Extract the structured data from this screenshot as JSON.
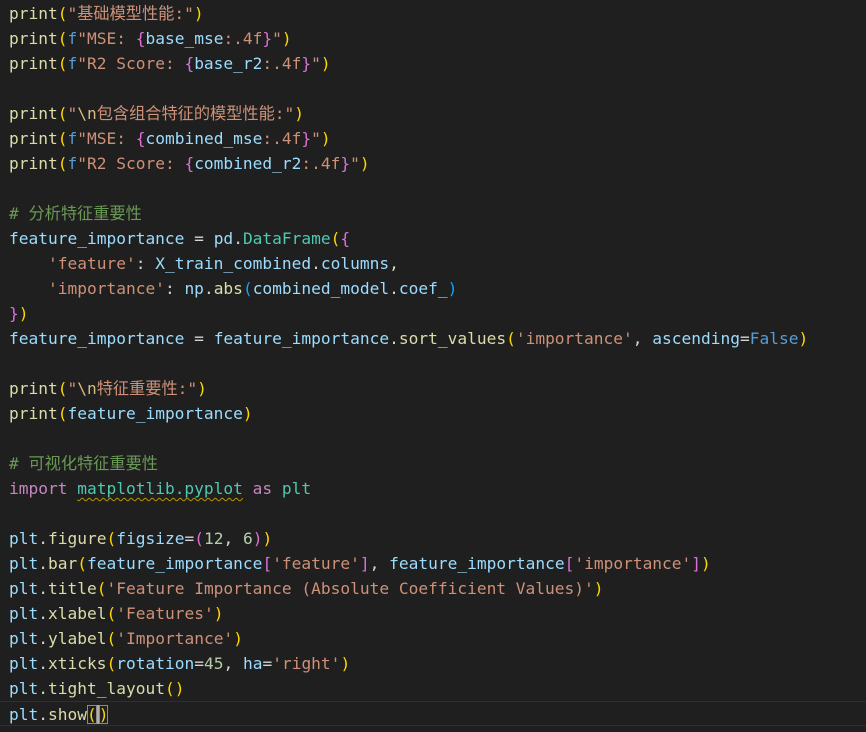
{
  "editor": {
    "colors": {
      "background": "#1f1f1f",
      "function": "#dcdcaa",
      "string": "#ce9178",
      "variable": "#9cdcfe",
      "comment": "#6a9955",
      "keyword": "#c586c0",
      "storage": "#569cd6",
      "class": "#4ec9b0",
      "number": "#b5cea8",
      "escape": "#d7ba7d",
      "plain": "#d4d4d4",
      "bracket1": "#ffd700",
      "bracket2": "#da70d6",
      "bracket3": "#179fff"
    },
    "current_line": 28,
    "lines": [
      [
        [
          "print",
          "fn"
        ],
        [
          "(",
          "b1"
        ],
        [
          "\"基础模型性能:\"",
          "str"
        ],
        [
          ")",
          "b1"
        ]
      ],
      [
        [
          "print",
          "fn"
        ],
        [
          "(",
          "b1"
        ],
        [
          "f",
          "kw2"
        ],
        [
          "\"MSE: ",
          "str"
        ],
        [
          "{",
          "b2"
        ],
        [
          "base_mse",
          "var"
        ],
        [
          ":.4f",
          "str"
        ],
        [
          "}",
          "b2"
        ],
        [
          "\"",
          "str"
        ],
        [
          ")",
          "b1"
        ]
      ],
      [
        [
          "print",
          "fn"
        ],
        [
          "(",
          "b1"
        ],
        [
          "f",
          "kw2"
        ],
        [
          "\"R2 Score: ",
          "str"
        ],
        [
          "{",
          "b2"
        ],
        [
          "base_r2",
          "var"
        ],
        [
          ":.4f",
          "str"
        ],
        [
          "}",
          "b2"
        ],
        [
          "\"",
          "str"
        ],
        [
          ")",
          "b1"
        ]
      ],
      [],
      [
        [
          "print",
          "fn"
        ],
        [
          "(",
          "b1"
        ],
        [
          "\"",
          "str"
        ],
        [
          "\\n",
          "esc"
        ],
        [
          "包含组合特征的模型性能:\"",
          "str"
        ],
        [
          ")",
          "b1"
        ]
      ],
      [
        [
          "print",
          "fn"
        ],
        [
          "(",
          "b1"
        ],
        [
          "f",
          "kw2"
        ],
        [
          "\"MSE: ",
          "str"
        ],
        [
          "{",
          "b2"
        ],
        [
          "combined_mse",
          "var"
        ],
        [
          ":.4f",
          "str"
        ],
        [
          "}",
          "b2"
        ],
        [
          "\"",
          "str"
        ],
        [
          ")",
          "b1"
        ]
      ],
      [
        [
          "print",
          "fn"
        ],
        [
          "(",
          "b1"
        ],
        [
          "f",
          "kw2"
        ],
        [
          "\"R2 Score: ",
          "str"
        ],
        [
          "{",
          "b2"
        ],
        [
          "combined_r2",
          "var"
        ],
        [
          ":.4f",
          "str"
        ],
        [
          "}",
          "b2"
        ],
        [
          "\"",
          "str"
        ],
        [
          ")",
          "b1"
        ]
      ],
      [],
      [
        [
          "# 分析特征重要性",
          "cmt"
        ]
      ],
      [
        [
          "feature_importance",
          "var"
        ],
        [
          " = ",
          "pl"
        ],
        [
          "pd",
          "var"
        ],
        [
          ".",
          "pl"
        ],
        [
          "DataFrame",
          "cls"
        ],
        [
          "(",
          "b1"
        ],
        [
          "{",
          "b2"
        ]
      ],
      [
        [
          "    ",
          "pl"
        ],
        [
          "'feature'",
          "str"
        ],
        [
          ": ",
          "pl"
        ],
        [
          "X_train_combined",
          "var"
        ],
        [
          ".",
          "pl"
        ],
        [
          "columns",
          "var"
        ],
        [
          ",",
          "pl"
        ]
      ],
      [
        [
          "    ",
          "pl"
        ],
        [
          "'importance'",
          "str"
        ],
        [
          ": ",
          "pl"
        ],
        [
          "np",
          "var"
        ],
        [
          ".",
          "pl"
        ],
        [
          "abs",
          "fn"
        ],
        [
          "(",
          "b3"
        ],
        [
          "combined_model",
          "var"
        ],
        [
          ".",
          "pl"
        ],
        [
          "coef_",
          "var"
        ],
        [
          ")",
          "b3"
        ]
      ],
      [
        [
          "}",
          "b2"
        ],
        [
          ")",
          "b1"
        ]
      ],
      [
        [
          "feature_importance",
          "var"
        ],
        [
          " = ",
          "pl"
        ],
        [
          "feature_importance",
          "var"
        ],
        [
          ".",
          "pl"
        ],
        [
          "sort_values",
          "fn"
        ],
        [
          "(",
          "b1"
        ],
        [
          "'importance'",
          "str"
        ],
        [
          ", ",
          "pl"
        ],
        [
          "ascending",
          "var"
        ],
        [
          "=",
          "pl"
        ],
        [
          "False",
          "kw2"
        ],
        [
          ")",
          "b1"
        ]
      ],
      [],
      [
        [
          "print",
          "fn"
        ],
        [
          "(",
          "b1"
        ],
        [
          "\"",
          "str"
        ],
        [
          "\\n",
          "esc"
        ],
        [
          "特征重要性:\"",
          "str"
        ],
        [
          ")",
          "b1"
        ]
      ],
      [
        [
          "print",
          "fn"
        ],
        [
          "(",
          "b1"
        ],
        [
          "feature_importance",
          "var"
        ],
        [
          ")",
          "b1"
        ]
      ],
      [],
      [
        [
          "# 可视化特征重要性",
          "cmt"
        ]
      ],
      [
        [
          "import",
          "kw"
        ],
        [
          " ",
          "pl"
        ],
        [
          "matplotlib.pyplot",
          "cls sq"
        ],
        [
          " ",
          "pl"
        ],
        [
          "as",
          "kw"
        ],
        [
          " ",
          "pl"
        ],
        [
          "plt",
          "cls"
        ]
      ],
      [],
      [
        [
          "plt",
          "var"
        ],
        [
          ".",
          "pl"
        ],
        [
          "figure",
          "fn"
        ],
        [
          "(",
          "b1"
        ],
        [
          "figsize",
          "var"
        ],
        [
          "=",
          "pl"
        ],
        [
          "(",
          "b2"
        ],
        [
          "12",
          "num"
        ],
        [
          ", ",
          "pl"
        ],
        [
          "6",
          "num"
        ],
        [
          ")",
          "b2"
        ],
        [
          ")",
          "b1"
        ]
      ],
      [
        [
          "plt",
          "var"
        ],
        [
          ".",
          "pl"
        ],
        [
          "bar",
          "fn"
        ],
        [
          "(",
          "b1"
        ],
        [
          "feature_importance",
          "var"
        ],
        [
          "[",
          "b2"
        ],
        [
          "'feature'",
          "str"
        ],
        [
          "]",
          "b2"
        ],
        [
          ", ",
          "pl"
        ],
        [
          "feature_importance",
          "var"
        ],
        [
          "[",
          "b2"
        ],
        [
          "'importance'",
          "str"
        ],
        [
          "]",
          "b2"
        ],
        [
          ")",
          "b1"
        ]
      ],
      [
        [
          "plt",
          "var"
        ],
        [
          ".",
          "pl"
        ],
        [
          "title",
          "fn"
        ],
        [
          "(",
          "b1"
        ],
        [
          "'Feature Importance (Absolute Coefficient Values)'",
          "str"
        ],
        [
          ")",
          "b1"
        ]
      ],
      [
        [
          "plt",
          "var"
        ],
        [
          ".",
          "pl"
        ],
        [
          "xlabel",
          "fn"
        ],
        [
          "(",
          "b1"
        ],
        [
          "'Features'",
          "str"
        ],
        [
          ")",
          "b1"
        ]
      ],
      [
        [
          "plt",
          "var"
        ],
        [
          ".",
          "pl"
        ],
        [
          "ylabel",
          "fn"
        ],
        [
          "(",
          "b1"
        ],
        [
          "'Importance'",
          "str"
        ],
        [
          ")",
          "b1"
        ]
      ],
      [
        [
          "plt",
          "var"
        ],
        [
          ".",
          "pl"
        ],
        [
          "xticks",
          "fn"
        ],
        [
          "(",
          "b1"
        ],
        [
          "rotation",
          "var"
        ],
        [
          "=",
          "pl"
        ],
        [
          "45",
          "num"
        ],
        [
          ", ",
          "pl"
        ],
        [
          "ha",
          "var"
        ],
        [
          "=",
          "pl"
        ],
        [
          "'right'",
          "str"
        ],
        [
          ")",
          "b1"
        ]
      ],
      [
        [
          "plt",
          "var"
        ],
        [
          ".",
          "pl"
        ],
        [
          "tight_layout",
          "fn"
        ],
        [
          "(",
          "b1"
        ],
        [
          ")",
          "b1"
        ]
      ],
      [
        [
          "plt",
          "var"
        ],
        [
          ".",
          "pl"
        ],
        [
          "show",
          "fn"
        ],
        [
          "(",
          "b1 bm"
        ],
        [
          ")",
          "b1 bm"
        ]
      ]
    ]
  }
}
